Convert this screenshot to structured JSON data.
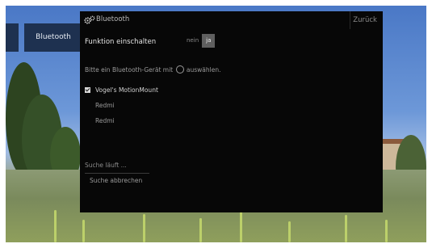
{
  "side_menu": {
    "item_label": "Bluetooth"
  },
  "panel": {
    "title": "Bluetooth",
    "back_label": "Zurück",
    "function_label": "Funktion einschalten",
    "toggle": {
      "off_label": "nein",
      "on_label": "ja",
      "selected": "ja"
    },
    "hint_before": "Bitte ein Bluetooth-Gerät mit",
    "hint_after": "auswählen.",
    "devices": [
      {
        "name": "Vogel's MotionMount",
        "checked": true
      },
      {
        "name": "Redmi",
        "checked": false
      },
      {
        "name": "Redmi",
        "checked": false
      }
    ],
    "search_status": "Suche läuft ...",
    "cancel_label": "Suche abbrechen"
  },
  "icons": {
    "title": "gears-icon",
    "hint": "ok-button-icon",
    "device_check": "checkbox-checked-icon"
  }
}
